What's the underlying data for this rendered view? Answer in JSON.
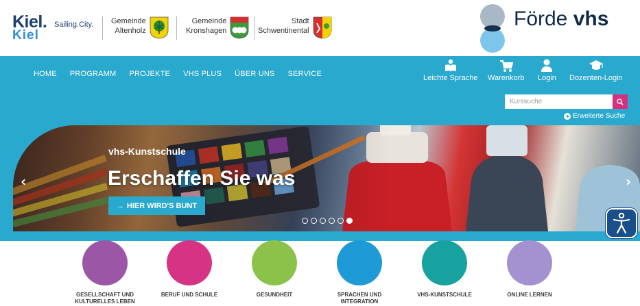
{
  "header": {
    "kiel": {
      "word": "Kiel.",
      "word_alt": "Kiel",
      "tagline": "Sailing.City."
    },
    "municipalities": [
      {
        "line1": "Gemeinde",
        "line2": "Altenholz"
      },
      {
        "line1": "Gemeinde",
        "line2": "Kronshagen"
      },
      {
        "line1": "Stadt",
        "line2": "Schwentinental"
      }
    ],
    "brand": {
      "light": "Förde ",
      "bold": "vhs"
    }
  },
  "nav": {
    "main": [
      "HOME",
      "PROGRAMM",
      "PROJEKTE",
      "VHS PLUS",
      "ÜBER UNS",
      "SERVICE"
    ],
    "utility": [
      {
        "label": "Leichte Sprache",
        "icon": "book-reader-icon"
      },
      {
        "label": "Warenkorb",
        "icon": "cart-icon"
      },
      {
        "label": "Login",
        "icon": "user-icon"
      },
      {
        "label": "Dozenten-Login",
        "icon": "graduation-cap-icon"
      }
    ],
    "search_placeholder": "Kurssuche",
    "advanced_search": "Erweiterte Suche"
  },
  "hero": {
    "kicker": "vhs-Kunstschule",
    "title": "Erschaffen Sie was",
    "cta": "HIER WIRD'S BUNT",
    "slide_count": 6,
    "active_slide": 6
  },
  "categories": [
    {
      "line1": "GESELLSCHAFT UND",
      "line2": "KULTURELLES LEBEN",
      "color": "#9b57a5"
    },
    {
      "line1": "BERUF UND SCHULE",
      "line2": "",
      "color": "#d63384"
    },
    {
      "line1": "GESUNDHEIT",
      "line2": "",
      "color": "#8bc34a"
    },
    {
      "line1": "SPRACHEN UND",
      "line2": "INTEGRATION",
      "color": "#1e9ad6"
    },
    {
      "line1": "VHS-KUNSTSCHULE",
      "line2": "",
      "color": "#17a2a0"
    },
    {
      "line1": "ONLINE LERNEN",
      "line2": "",
      "color": "#a392cf"
    }
  ],
  "colors": {
    "nav": "#2aa9ce",
    "search_button": "#d52f7d",
    "accessibility": "#1a4f8a"
  }
}
